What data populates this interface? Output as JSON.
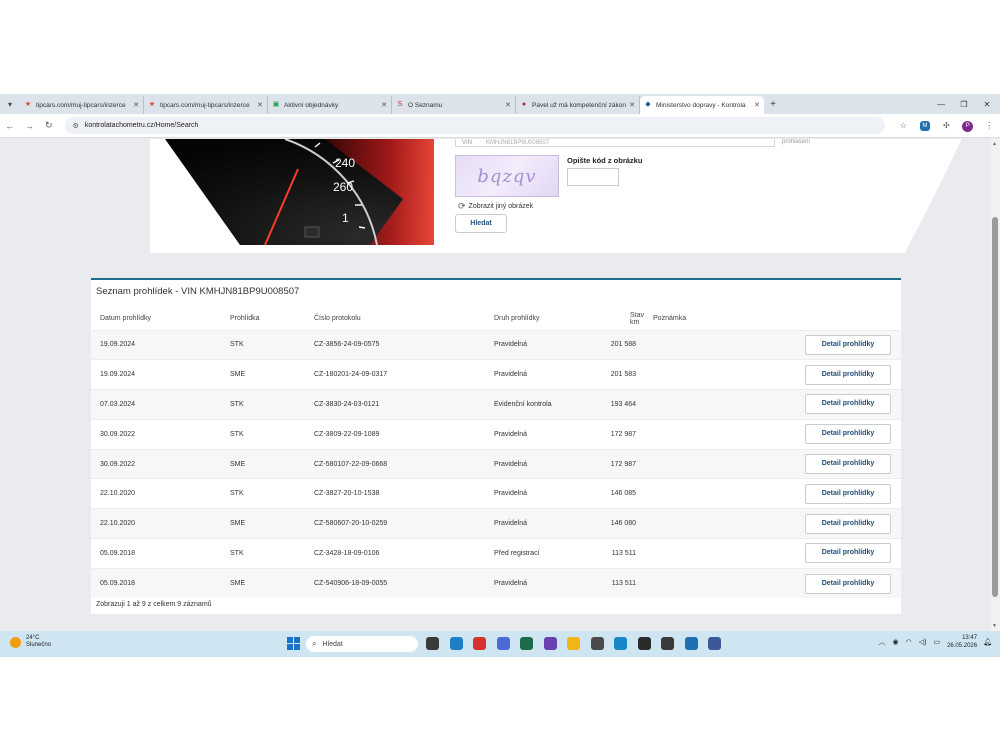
{
  "browser": {
    "tabs": [
      {
        "title": "tipcars.com/muj-tipcars/inzerce",
        "fav": "★",
        "fav_color": "#e0463b",
        "active": false
      },
      {
        "title": "tipcars.com/muj-tipcars/inzerce",
        "fav": "★",
        "fav_color": "#e0463b",
        "active": false
      },
      {
        "title": "Aktivní objednávky",
        "fav": "▣",
        "fav_color": "#1b9b4b",
        "active": false
      },
      {
        "title": "O Seznamu",
        "fav": "S",
        "fav_color": "#d22f27",
        "active": false
      },
      {
        "title": "Pavel už má kompetenční zákon",
        "fav": "●",
        "fav_color": "#c2185b",
        "active": false
      },
      {
        "title": "Ministerstvo dopravy - Kontrola",
        "fav": "◆",
        "fav_color": "#2a5a9c",
        "active": true
      }
    ],
    "url": "kontrolatachometru.cz/Home/Search",
    "profile_initial": "P",
    "ext_badge": "M"
  },
  "search_form": {
    "vin_label": "VIN",
    "vin_value": "KMHJN81BP9U008507",
    "prohl_link": "prohlášení",
    "captcha_text": "bqzqv",
    "captcha_label": "Opište kód z obrázku",
    "refresh_label": "Zobrazit jiný obrázek",
    "search_button": "Hledat"
  },
  "results": {
    "title": "Seznam prohlídek - VIN KMHJN81BP9U008507",
    "columns": [
      "Datum prohlídky",
      "Prohlídka",
      "Číslo protokolu",
      "Druh prohlídky",
      "Stav km",
      "Poznámka"
    ],
    "detail_label": "Detail prohlídky",
    "rows": [
      {
        "date": "19.09.2024",
        "type": "STK",
        "protocol": "CZ-3856-24-09-0575",
        "kind": "Pravidelná",
        "km": "201 588",
        "note": ""
      },
      {
        "date": "19.09.2024",
        "type": "SME",
        "protocol": "CZ-180201-24-09-0317",
        "kind": "Pravidelná",
        "km": "201 583",
        "note": ""
      },
      {
        "date": "07.03.2024",
        "type": "STK",
        "protocol": "CZ-3830-24-03-0121",
        "kind": "Evidenční kontrola",
        "km": "193 464",
        "note": ""
      },
      {
        "date": "30.09.2022",
        "type": "STK",
        "protocol": "CZ-3809-22-09-1089",
        "kind": "Pravidelná",
        "km": "172 987",
        "note": ""
      },
      {
        "date": "30.09.2022",
        "type": "SME",
        "protocol": "CZ-580107-22-09-0668",
        "kind": "Pravidelná",
        "km": "172 987",
        "note": ""
      },
      {
        "date": "22.10.2020",
        "type": "STK",
        "protocol": "CZ-3827-20-10-1538",
        "kind": "Pravidelná",
        "km": "146 085",
        "note": ""
      },
      {
        "date": "22.10.2020",
        "type": "SME",
        "protocol": "CZ-580607-20-10-0259",
        "kind": "Pravidelná",
        "km": "146 080",
        "note": ""
      },
      {
        "date": "05.09.2018",
        "type": "STK",
        "protocol": "CZ-3428-18-09-0106",
        "kind": "Před registrací",
        "km": "113 511",
        "note": ""
      },
      {
        "date": "05.09.2018",
        "type": "SME",
        "protocol": "CZ-540906-18-09-0055",
        "kind": "Pravidelná",
        "km": "113 511",
        "note": ""
      }
    ],
    "footer": "Zobrazuji 1 až 9 z celkem 9 záznamů"
  },
  "taskbar": {
    "weather_temp": "24°C",
    "weather_desc": "Slunečno",
    "search_placeholder": "Hledat",
    "time": "13:47",
    "date": "26.05.2026",
    "app_colors": [
      "#3a3a3a",
      "#1e7fc4",
      "#d6322f",
      "#4d6bd6",
      "#1d6b4a",
      "#6a3fb0",
      "#f2b416",
      "#4a4a4a",
      "#1787c9",
      "#2b2b2b",
      "#3a3a3a",
      "#1f6fb5",
      "#3b5998"
    ]
  }
}
